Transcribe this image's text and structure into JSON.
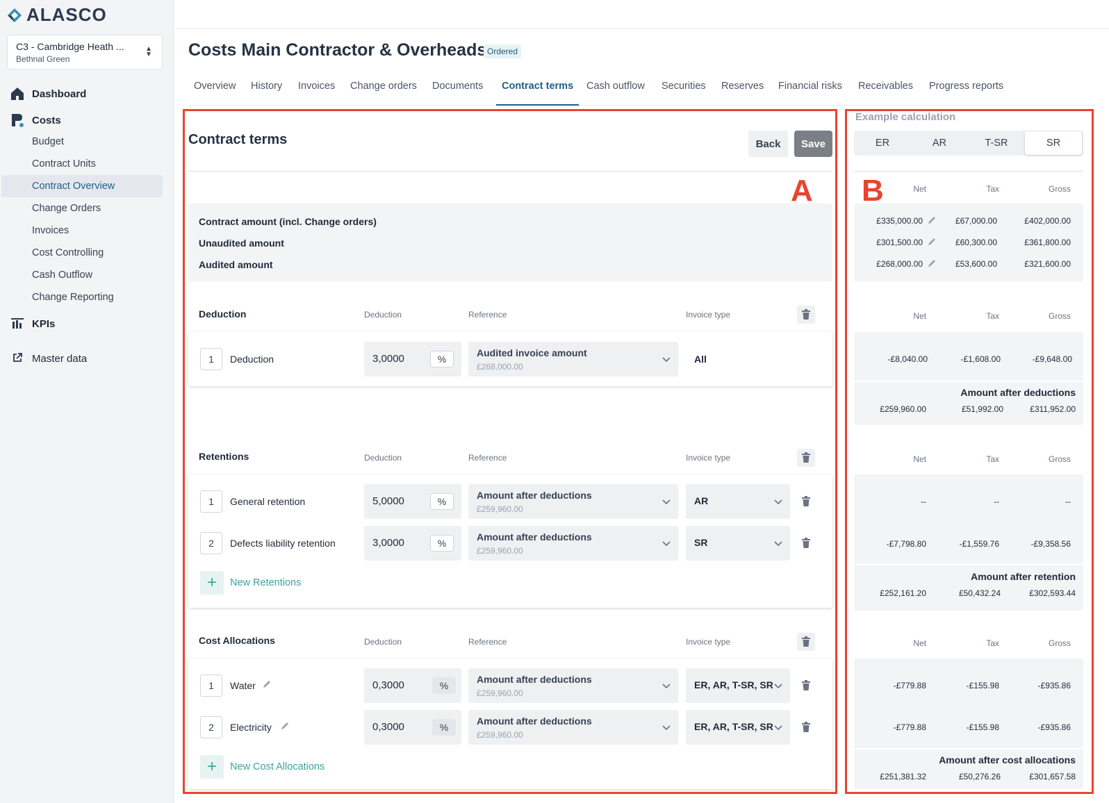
{
  "app": {
    "logo": "ALASCO"
  },
  "project": {
    "name": "C3 - Cambridge Heath ...",
    "location": "Bethnal Green"
  },
  "nav": {
    "dashboard": "Dashboard",
    "costs": "Costs",
    "costs_items": [
      "Budget",
      "Contract Units",
      "Contract Overview",
      "Change Orders",
      "Invoices",
      "Cost Controlling",
      "Cash Outflow",
      "Change Reporting"
    ],
    "kpis": "KPIs",
    "master_data": "Master data"
  },
  "page": {
    "title": "Costs Main Contractor & Overheads",
    "status": "Ordered"
  },
  "tabs": [
    "Overview",
    "History",
    "Invoices",
    "Change orders",
    "Documents",
    "Contract terms",
    "Cash outflow",
    "Securities",
    "Reserves",
    "Financial risks",
    "Receivables",
    "Progress reports"
  ],
  "active_tab": "Contract terms",
  "annotations": {
    "a": "A",
    "b": "B"
  },
  "contract": {
    "heading": "Contract terms",
    "back": "Back",
    "save": "Save",
    "amounts": [
      "Contract amount (incl. Change orders)",
      "Unaudited amount",
      "Audited amount"
    ],
    "columns": {
      "deduction": "Deduction",
      "reference": "Reference",
      "invoice_type": "Invoice type"
    },
    "deduction": {
      "title": "Deduction",
      "rows": [
        {
          "n": "1",
          "name": "Deduction",
          "value": "3,0000",
          "unit": "%",
          "ref": "Audited invoice amount",
          "ref_sub": "£268,000.00",
          "type": "All"
        }
      ]
    },
    "retentions": {
      "title": "Retentions",
      "rows": [
        {
          "n": "1",
          "name": "General retention",
          "value": "5,0000",
          "unit": "%",
          "ref": "Amount after deductions",
          "ref_sub": "£259,960.00",
          "type": "AR"
        },
        {
          "n": "2",
          "name": "Defects liability retention",
          "value": "3,0000",
          "unit": "%",
          "ref": "Amount after deductions",
          "ref_sub": "£259,960.00",
          "type": "SR"
        }
      ],
      "add": "New Retentions"
    },
    "allocations": {
      "title": "Cost Allocations",
      "rows": [
        {
          "n": "1",
          "name": "Water",
          "value": "0,3000",
          "unit": "%",
          "ref": "Amount after deductions",
          "ref_sub": "£259,960.00",
          "type": "ER, AR, T-SR, SR"
        },
        {
          "n": "2",
          "name": "Electricity",
          "value": "0,3000",
          "unit": "%",
          "ref": "Amount after deductions",
          "ref_sub": "£259,960.00",
          "type": "ER, AR, T-SR, SR"
        }
      ],
      "add": "New Cost Allocations"
    }
  },
  "example": {
    "heading": "Example calculation",
    "segments": [
      "ER",
      "AR",
      "T-SR",
      "SR"
    ],
    "active_segment": "SR",
    "headers": {
      "net": "Net",
      "tax": "Tax",
      "gross": "Gross"
    },
    "amounts": [
      {
        "net": "£335,000.00",
        "tax": "£67,000.00",
        "gross": "£402,000.00"
      },
      {
        "net": "£301,500.00",
        "tax": "£60,300.00",
        "gross": "£361,800.00"
      },
      {
        "net": "£268,000.00",
        "tax": "£53,600.00",
        "gross": "£321,600.00"
      }
    ],
    "deduction": {
      "net": "-£8,040.00",
      "tax": "-£1,608.00",
      "gross": "-£9,648.00"
    },
    "after_deductions": {
      "label": "Amount after deductions",
      "net": "£259,960.00",
      "tax": "£51,992.00",
      "gross": "£311,952.00"
    },
    "retentions": [
      {
        "net": "--",
        "tax": "--",
        "gross": "--"
      },
      {
        "net": "-£7,798.80",
        "tax": "-£1,559.76",
        "gross": "-£9,358.56"
      }
    ],
    "after_retention": {
      "label": "Amount after retention",
      "net": "£252,161.20",
      "tax": "£50,432.24",
      "gross": "£302,593.44"
    },
    "allocations": [
      {
        "net": "-£779.88",
        "tax": "-£155.98",
        "gross": "-£935.86"
      },
      {
        "net": "-£779.88",
        "tax": "-£155.98",
        "gross": "-£935.86"
      }
    ],
    "after_allocations": {
      "label": "Amount after cost allocations",
      "net": "£251,381.32",
      "tax": "£50,276.26",
      "gross": "£301,657.58"
    }
  },
  "colors": {
    "accent": "#1c5f86",
    "highlight": "#e8442f",
    "teal": "#3aa59a"
  }
}
